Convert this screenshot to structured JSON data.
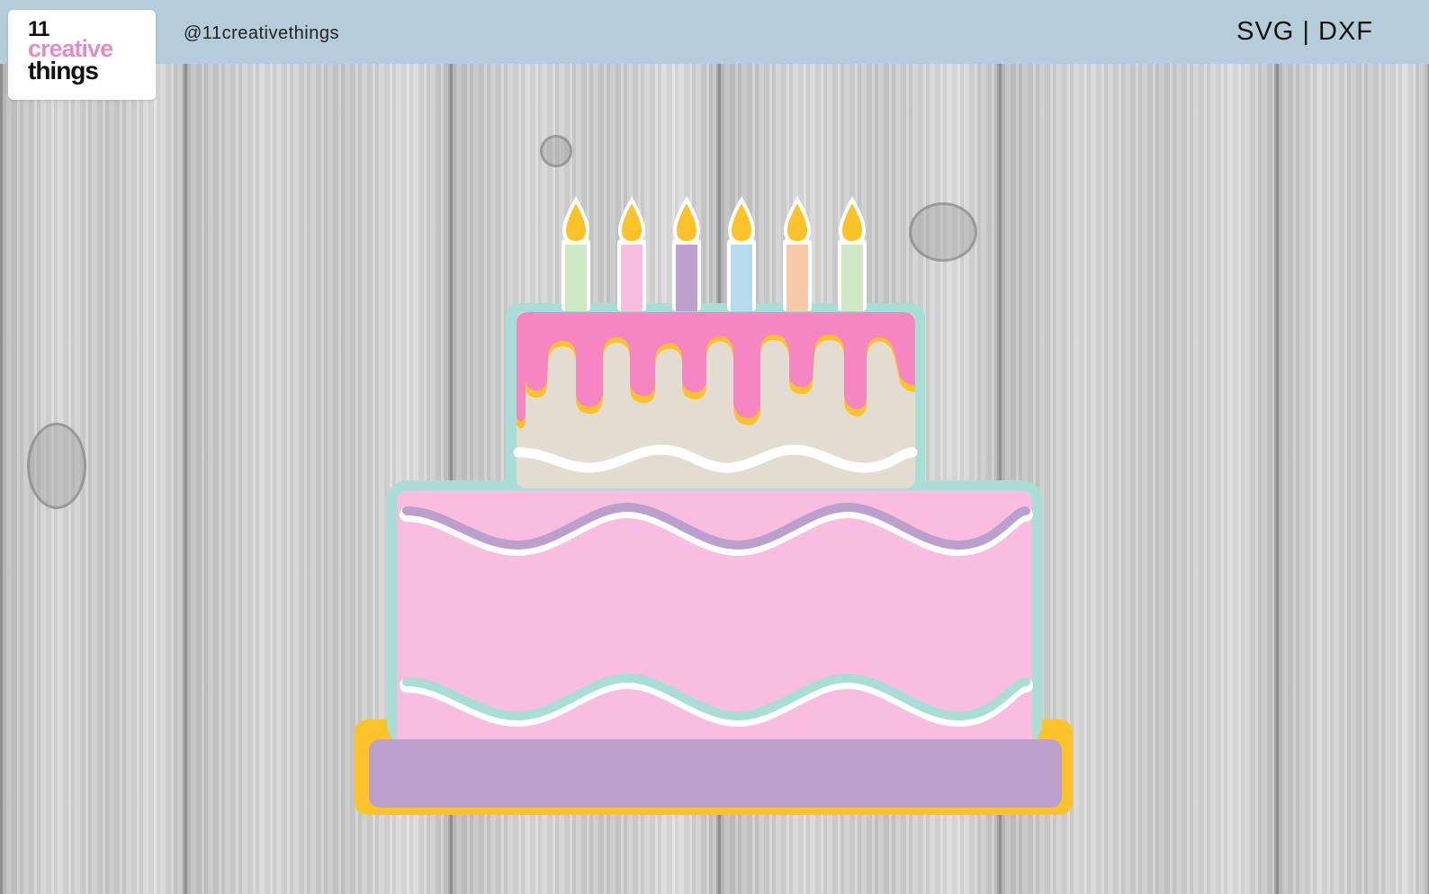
{
  "header": {
    "logo": {
      "line1": "11",
      "line2": "creative",
      "line3": "things"
    },
    "handle": "@11creativethings",
    "formats": "SVG | DXF"
  },
  "colors": {
    "banner": "#b5cddb",
    "outline": "#a8ded5",
    "pink_top": "#f586c1",
    "cream": "#e2ddd0",
    "pink_bottom": "#f9bedf",
    "purple": "#bb9fcd",
    "gold": "#fcc22a",
    "mint": "#a8ded5"
  },
  "icons": [
    "birthday-cake-icon",
    "candle-icon",
    "flame-icon"
  ]
}
